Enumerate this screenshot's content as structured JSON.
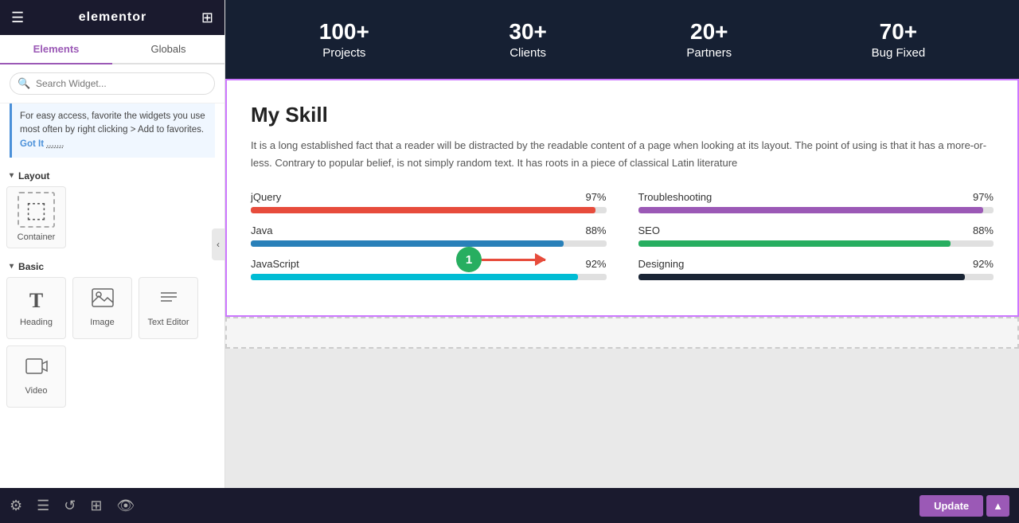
{
  "header": {
    "title": "elementor",
    "menu_icon": "☰",
    "grid_icon": "⊞"
  },
  "tabs": {
    "elements_label": "Elements",
    "globals_label": "Globals",
    "active": "elements"
  },
  "search": {
    "placeholder": "Search Widget..."
  },
  "info_box": {
    "text": "For easy access, favorite the widgets you use most often by right clicking > Add to favorites.",
    "link_text": "Got It",
    "dotted_text": "......."
  },
  "layout_section": {
    "label": "Layout",
    "chevron": "▾"
  },
  "widgets": {
    "container": {
      "icon": "⬚",
      "label": "Container"
    }
  },
  "basic_section": {
    "label": "Basic",
    "chevron": "▾"
  },
  "basic_widgets": [
    {
      "icon": "T",
      "label": "Heading"
    },
    {
      "icon": "🖼",
      "label": "Image"
    },
    {
      "icon": "≡",
      "label": "Text Editor"
    },
    {
      "icon": "▶",
      "label": "Video"
    }
  ],
  "stats": [
    {
      "number": "100+",
      "label": "Projects"
    },
    {
      "number": "30+",
      "label": "Clients"
    },
    {
      "number": "20+",
      "label": "Partners"
    },
    {
      "number": "70+",
      "label": "Bug Fixed"
    }
  ],
  "skills_section": {
    "title": "My Skill",
    "description": "It is a long established fact that a reader will be distracted by the readable content of a page when looking at its layout. The point of using is that it has a more-or-less. Contrary to popular belief, is not simply random text. It has roots in a piece of classical Latin literature",
    "skills_left": [
      {
        "name": "jQuery",
        "percent": 97,
        "color": "#e74c3c"
      },
      {
        "name": "Java",
        "percent": 88,
        "color": "#2980b9"
      },
      {
        "name": "JavaScript",
        "percent": 92,
        "color": "#00bcd4"
      }
    ],
    "skills_right": [
      {
        "name": "Troubleshooting",
        "percent": 97,
        "color": "#9b59b6"
      },
      {
        "name": "SEO",
        "percent": 88,
        "color": "#27ae60"
      },
      {
        "name": "Designing",
        "percent": 92,
        "color": "#1a2535"
      }
    ]
  },
  "annotation": {
    "number": "1"
  },
  "bottom_bar": {
    "update_label": "Update",
    "chevron_up": "▲",
    "icons": [
      "⚙",
      "☰",
      "↺",
      "⊞",
      "👁"
    ]
  }
}
